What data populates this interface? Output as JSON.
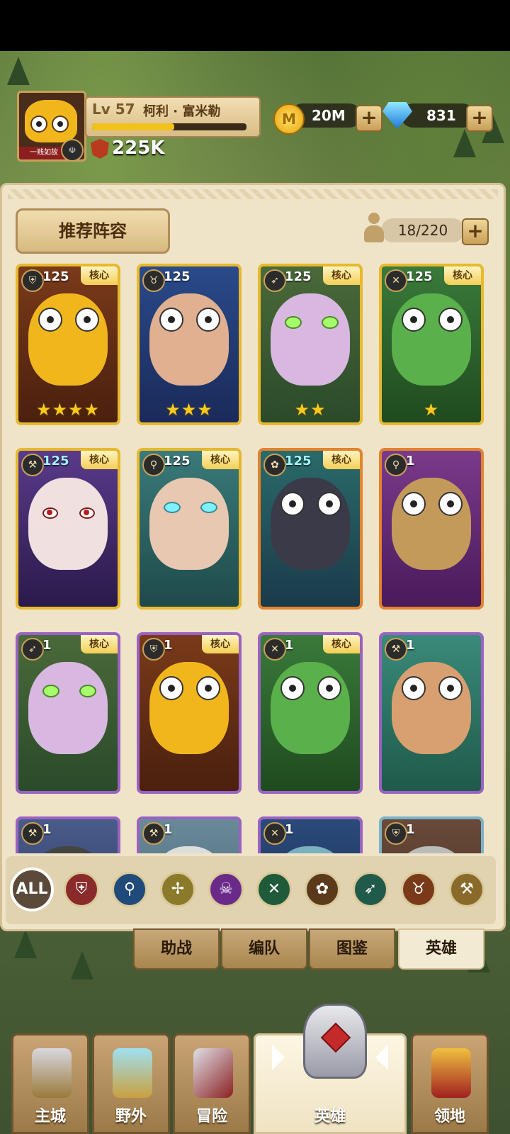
{
  "player": {
    "level": "Lv 57",
    "name": "柯利 · 富米勒",
    "xp_progress": 0.53,
    "avatar_tag": "一贱如故",
    "power": "225K"
  },
  "resources": {
    "coin_glyph": "M",
    "coins": "20M",
    "gems": "831",
    "plus": "+"
  },
  "panel": {
    "recommend_label": "推荐阵容",
    "hero_count": "18/220",
    "plus": "+"
  },
  "heroes": [
    {
      "level": "125",
      "core": "核心",
      "stars": "★★★★",
      "class_glyph": "⛨"
    },
    {
      "level": "125",
      "core": "",
      "stars": "★★★",
      "class_glyph": "♉"
    },
    {
      "level": "125",
      "core": "核心",
      "stars": "★★",
      "class_glyph": "➶"
    },
    {
      "level": "125",
      "core": "核心",
      "stars": "★",
      "class_glyph": "✕"
    },
    {
      "level": "125",
      "core": "核心",
      "stars": "",
      "class_glyph": "⚒"
    },
    {
      "level": "125",
      "core": "核心",
      "stars": "",
      "class_glyph": "⚲"
    },
    {
      "level": "125",
      "core": "核心",
      "stars": "",
      "class_glyph": "✿"
    },
    {
      "level": "1",
      "core": "",
      "stars": "",
      "class_glyph": "⚲"
    },
    {
      "level": "1",
      "core": "核心",
      "stars": "",
      "class_glyph": "➶"
    },
    {
      "level": "1",
      "core": "核心",
      "stars": "",
      "class_glyph": "⛨"
    },
    {
      "level": "1",
      "core": "核心",
      "stars": "",
      "class_glyph": "✕"
    },
    {
      "level": "1",
      "core": "",
      "stars": "",
      "class_glyph": "⚒"
    },
    {
      "level": "1",
      "core": "",
      "stars": "",
      "class_glyph": "⚒"
    },
    {
      "level": "1",
      "core": "",
      "stars": "",
      "class_glyph": "⚒"
    },
    {
      "level": "1",
      "core": "",
      "stars": "",
      "class_glyph": "✕"
    },
    {
      "level": "1",
      "core": "",
      "stars": "",
      "class_glyph": "⛨"
    }
  ],
  "filters": {
    "all_label": "ALL",
    "items": [
      {
        "icon": "shield-icon",
        "glyph": "⛨",
        "color": "#8b2a2a"
      },
      {
        "icon": "staff-icon",
        "glyph": "⚲",
        "color": "#1f4a7a"
      },
      {
        "icon": "holy-icon",
        "glyph": "✢",
        "color": "#8a7a2a"
      },
      {
        "icon": "skull-icon",
        "glyph": "☠",
        "color": "#6a2a8a"
      },
      {
        "icon": "daggers-icon",
        "glyph": "✕",
        "color": "#1f5a3a"
      },
      {
        "icon": "paw-icon",
        "glyph": "✿",
        "color": "#5a3a1a"
      },
      {
        "icon": "bow-icon",
        "glyph": "➶",
        "color": "#1f5a4a"
      },
      {
        "icon": "bull-icon",
        "glyph": "♉",
        "color": "#7a3a1a"
      },
      {
        "icon": "hammer-icon",
        "glyph": "⚒",
        "color": "#8a6a2a"
      }
    ]
  },
  "subtabs": [
    "助战",
    "编队",
    "图鉴",
    "英雄"
  ],
  "nav": [
    "主城",
    "野外",
    "冒险",
    "英雄",
    "领地"
  ]
}
